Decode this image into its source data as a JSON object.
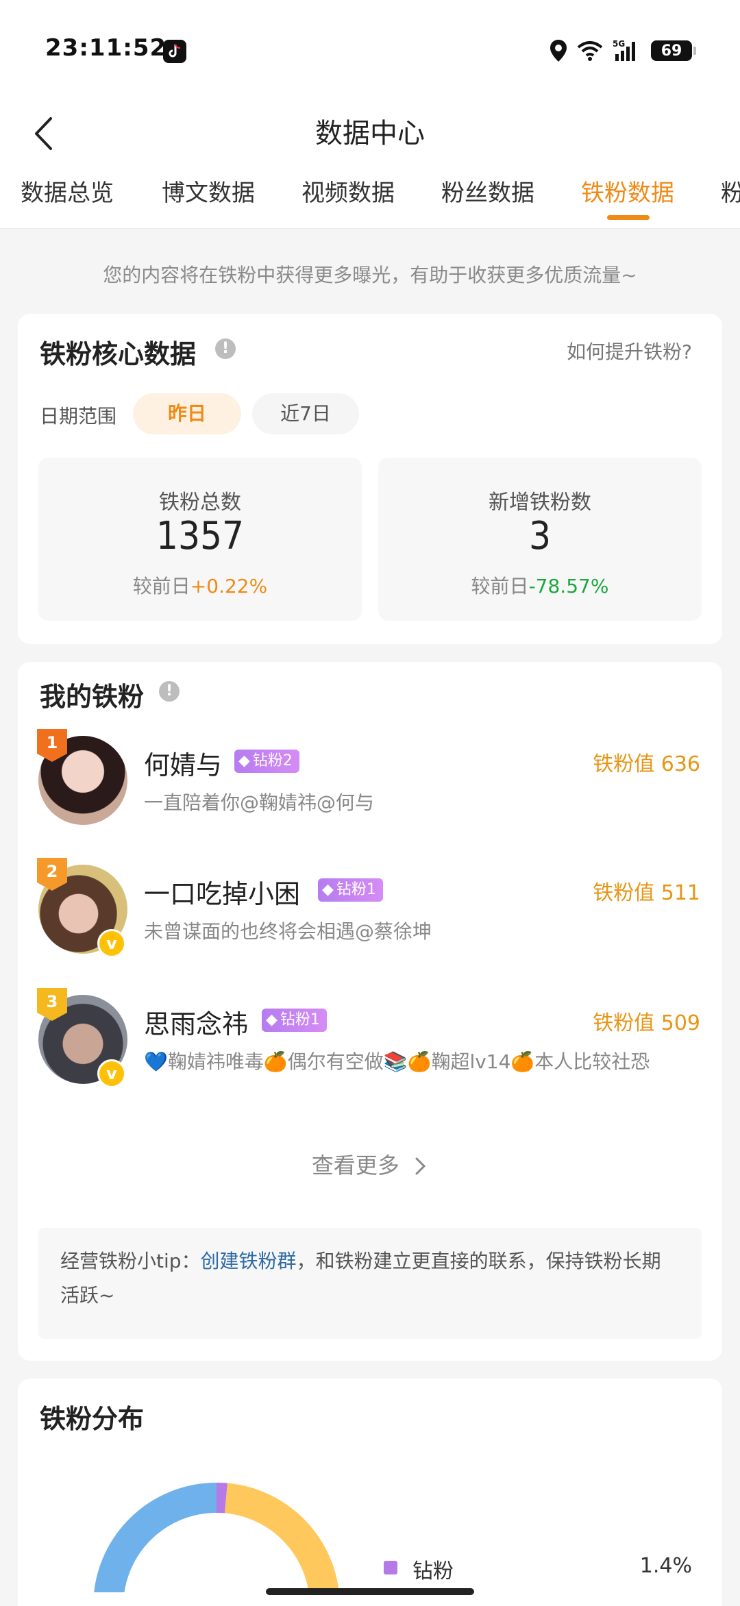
{
  "status": {
    "time": "23:11:52",
    "battery": "69"
  },
  "nav": {
    "title": "数据中心"
  },
  "tabs": [
    {
      "label": "数据总览"
    },
    {
      "label": "博文数据"
    },
    {
      "label": "视频数据"
    },
    {
      "label": "粉丝数据"
    },
    {
      "label": "铁粉数据"
    },
    {
      "label": "粉"
    }
  ],
  "notice": "您的内容将在铁粉中获得更多曝光，有助于收获更多优质流量~",
  "core": {
    "title": "铁粉核心数据",
    "help": "如何提升铁粉?",
    "date_label": "日期范围",
    "chip_yesterday": "昨日",
    "chip_week": "近7日",
    "total": {
      "label": "铁粉总数",
      "value": "1357",
      "cmp_prefix": "较前日",
      "cmp_value": "+0.22%"
    },
    "new": {
      "label": "新增铁粉数",
      "value": "3",
      "cmp_prefix": "较前日",
      "cmp_value": "-78.57%"
    }
  },
  "my_fans": {
    "title": "我的铁粉",
    "fans": [
      {
        "rank": "1",
        "name": "何婧与",
        "level": "钻粉2",
        "score": "铁粉值 636",
        "desc": "一直陪着你@鞠婧祎@何与",
        "rank_color": "#f0701e"
      },
      {
        "rank": "2",
        "name": "一口吃掉小困",
        "level": "钻粉1",
        "score": "铁粉值 511",
        "desc": "未曾谋面的也终将会相遇@蔡徐坤",
        "rank_color": "#f59a2a"
      },
      {
        "rank": "3",
        "name": "思雨念祎",
        "level": "钻粉1",
        "score": "铁粉值 509",
        "desc": "💙鞠婧祎唯毒🍊偶尔有空做📚🍊鞠超lv14🍊本人比较社恐",
        "rank_color": "#f5b81f"
      }
    ],
    "see_more": "查看更多",
    "tip_prefix": "经营铁粉小tip：",
    "tip_link": "创建铁粉群",
    "tip_suffix": "，和铁粉建立更直接的联系，保持铁粉长期活跃~"
  },
  "distribution": {
    "title": "铁粉分布",
    "legend_label": "钻粉",
    "legend_value": "1.4%"
  },
  "colors": {
    "accent": "#f08a16",
    "positive_change": "#f08a16",
    "negative_change": "#1aa83c",
    "link": "#2d6aa6"
  }
}
